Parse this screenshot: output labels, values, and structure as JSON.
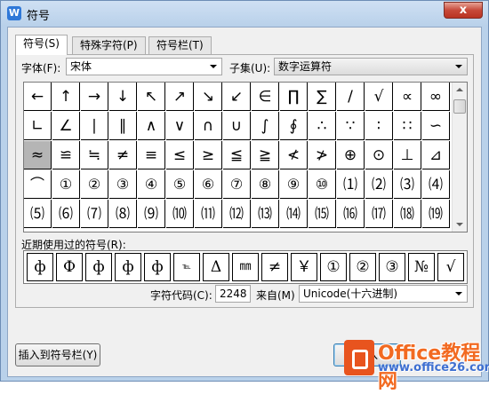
{
  "window": {
    "title": "符号",
    "app_icon": "W",
    "close_label": "x"
  },
  "tabs": [
    "符号(S)",
    "特殊字符(P)",
    "符号栏(T)"
  ],
  "font": {
    "label": "字体(F):",
    "value": "宋体"
  },
  "subset": {
    "label": "子集(U):",
    "value": "数字运算符"
  },
  "symbols": [
    [
      "←",
      "↑",
      "→",
      "↓",
      "↖",
      "↗",
      "↘",
      "↙",
      "∈",
      "∏",
      "∑",
      "/",
      "√",
      "∝",
      "∞"
    ],
    [
      "∟",
      "∠",
      "∣",
      "∥",
      "∧",
      "∨",
      "∩",
      "∪",
      "∫",
      "∮",
      "∴",
      "∵",
      "∶",
      "∷",
      "∽"
    ],
    [
      "≈",
      "≌",
      "≒",
      "≠",
      "≡",
      "≤",
      "≥",
      "≦",
      "≧",
      "≮",
      "≯",
      "⊕",
      "⊙",
      "⊥",
      "⊿"
    ],
    [
      "⌒",
      "①",
      "②",
      "③",
      "④",
      "⑤",
      "⑥",
      "⑦",
      "⑧",
      "⑨",
      "⑩",
      "⑴",
      "⑵",
      "⑶",
      "⑷"
    ],
    [
      "⑸",
      "⑹",
      "⑺",
      "⑻",
      "⑼",
      "⑽",
      "⑾",
      "⑿",
      "⒀",
      "⒁",
      "⒂",
      "⒃",
      "⒄",
      "⒅",
      "⒆"
    ]
  ],
  "selected_symbol": "≈",
  "recent": {
    "label": "近期使用过的符号(R):",
    "items": [
      "ф",
      "Ф",
      "ф",
      "ф",
      "ф",
      "℡",
      "Δ",
      "㎜",
      "≠",
      "￥",
      "①",
      "②",
      "③",
      "№",
      "√"
    ]
  },
  "char_code": {
    "label": "字符代码(C):",
    "value": "2248"
  },
  "from": {
    "label": "来自(M)",
    "value": "Unicode(十六进制)"
  },
  "buttons": {
    "insert_to_bar": "插入到符号栏(Y)",
    "insert": "插入"
  },
  "watermark": {
    "line1": "Office教程网",
    "line2": "www.office26.com"
  }
}
